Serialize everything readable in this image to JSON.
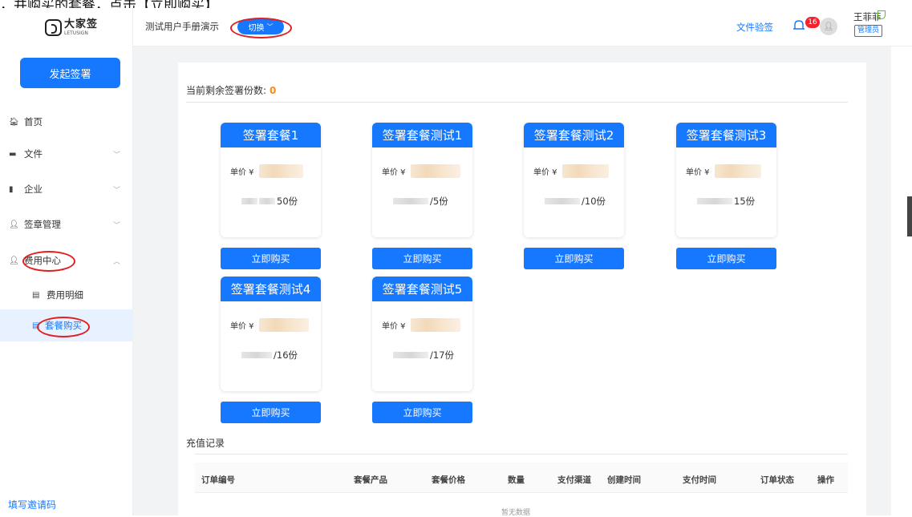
{
  "caption": "，并购买的套餐，点击【立即购买】",
  "sidebar": {
    "logo_cn": "大家签",
    "logo_en": "LETUSIGN",
    "start_label": "发起签署",
    "items": [
      {
        "label": "首页",
        "icon": "home-icon"
      },
      {
        "label": "文件",
        "icon": "folder-icon"
      },
      {
        "label": "企业",
        "icon": "building-icon"
      },
      {
        "label": "签章管理",
        "icon": "person-icon"
      },
      {
        "label": "费用中心",
        "icon": "person-icon"
      },
      {
        "label": "费用明细",
        "icon": "document-icon"
      },
      {
        "label": "套餐购买",
        "icon": "document-icon"
      }
    ],
    "invite_label": "填写邀请码"
  },
  "header": {
    "project": "测试用户手册演示",
    "switch_label": "切换",
    "verify_label": "文件验签",
    "notification_count": "16",
    "user_name": "王菲菲",
    "role": "管理员"
  },
  "main": {
    "remain_label": "当前剩余签署份数:",
    "remain_count": "0",
    "price_label": "单价 ¥",
    "buy_label": "立即购买",
    "packages": [
      {
        "name": "签署套餐1",
        "qty": "50份"
      },
      {
        "name": "签署套餐测试1",
        "qty": "/5份"
      },
      {
        "name": "签署套餐测试2",
        "qty": "/10份"
      },
      {
        "name": "签署套餐测试3",
        "qty": "15份"
      },
      {
        "name": "签署套餐测试4",
        "qty": "/16份"
      },
      {
        "name": "签署套餐测试5",
        "qty": "/17份"
      }
    ],
    "records_title": "充值记录",
    "columns": [
      "订单编号",
      "套餐产品",
      "套餐价格",
      "数量",
      "支付渠道",
      "创建时间",
      "支付时间",
      "订单状态",
      "操作"
    ],
    "empty_text": "暂无数据"
  },
  "colors": {
    "accent": "#1677ff",
    "badge": "#f5222d",
    "count": "#fa8c16",
    "annotation": "#e02020"
  }
}
